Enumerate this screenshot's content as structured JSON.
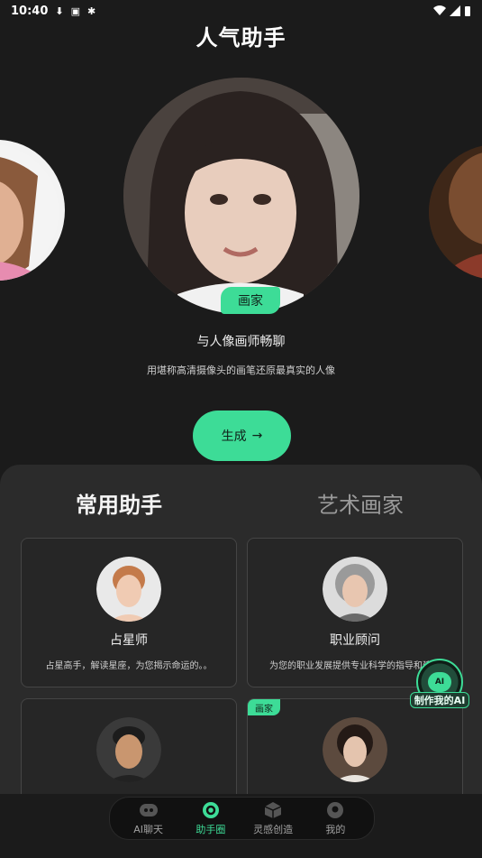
{
  "status_bar": {
    "time": "10:40"
  },
  "header": {
    "title": "人气助手"
  },
  "carousel": {
    "center": {
      "tag": "画家",
      "subtitle": "与人像画师畅聊",
      "description": "用堪称高清摄像头的画笔还原最真实的人像"
    }
  },
  "generate_button": {
    "label": "生成",
    "arrow": "→"
  },
  "tabs": [
    {
      "label": "常用助手",
      "active": true
    },
    {
      "label": "艺术画家",
      "active": false
    }
  ],
  "cards": [
    {
      "name": "占星师",
      "description": "占星高手，解读星座，为您揭示命运的。。"
    },
    {
      "name": "职业顾问",
      "description": "为您的职业发展提供专业科学的指导和建议"
    },
    {
      "name": "",
      "description": ""
    },
    {
      "name": "",
      "description": "",
      "badge": "画家"
    }
  ],
  "floating_button": {
    "label": "制作我的AI",
    "icon_text": "AI"
  },
  "bottom_nav": [
    {
      "label": "AI聊天",
      "active": false,
      "icon": "robot-icon"
    },
    {
      "label": "助手圈",
      "active": true,
      "icon": "circle-icon"
    },
    {
      "label": "灵感创造",
      "active": false,
      "icon": "cube-icon"
    },
    {
      "label": "我的",
      "active": false,
      "icon": "profile-icon"
    }
  ],
  "colors": {
    "accent": "#3ddc97",
    "background": "#1b1b1b",
    "sheet": "#2b2b2b"
  }
}
